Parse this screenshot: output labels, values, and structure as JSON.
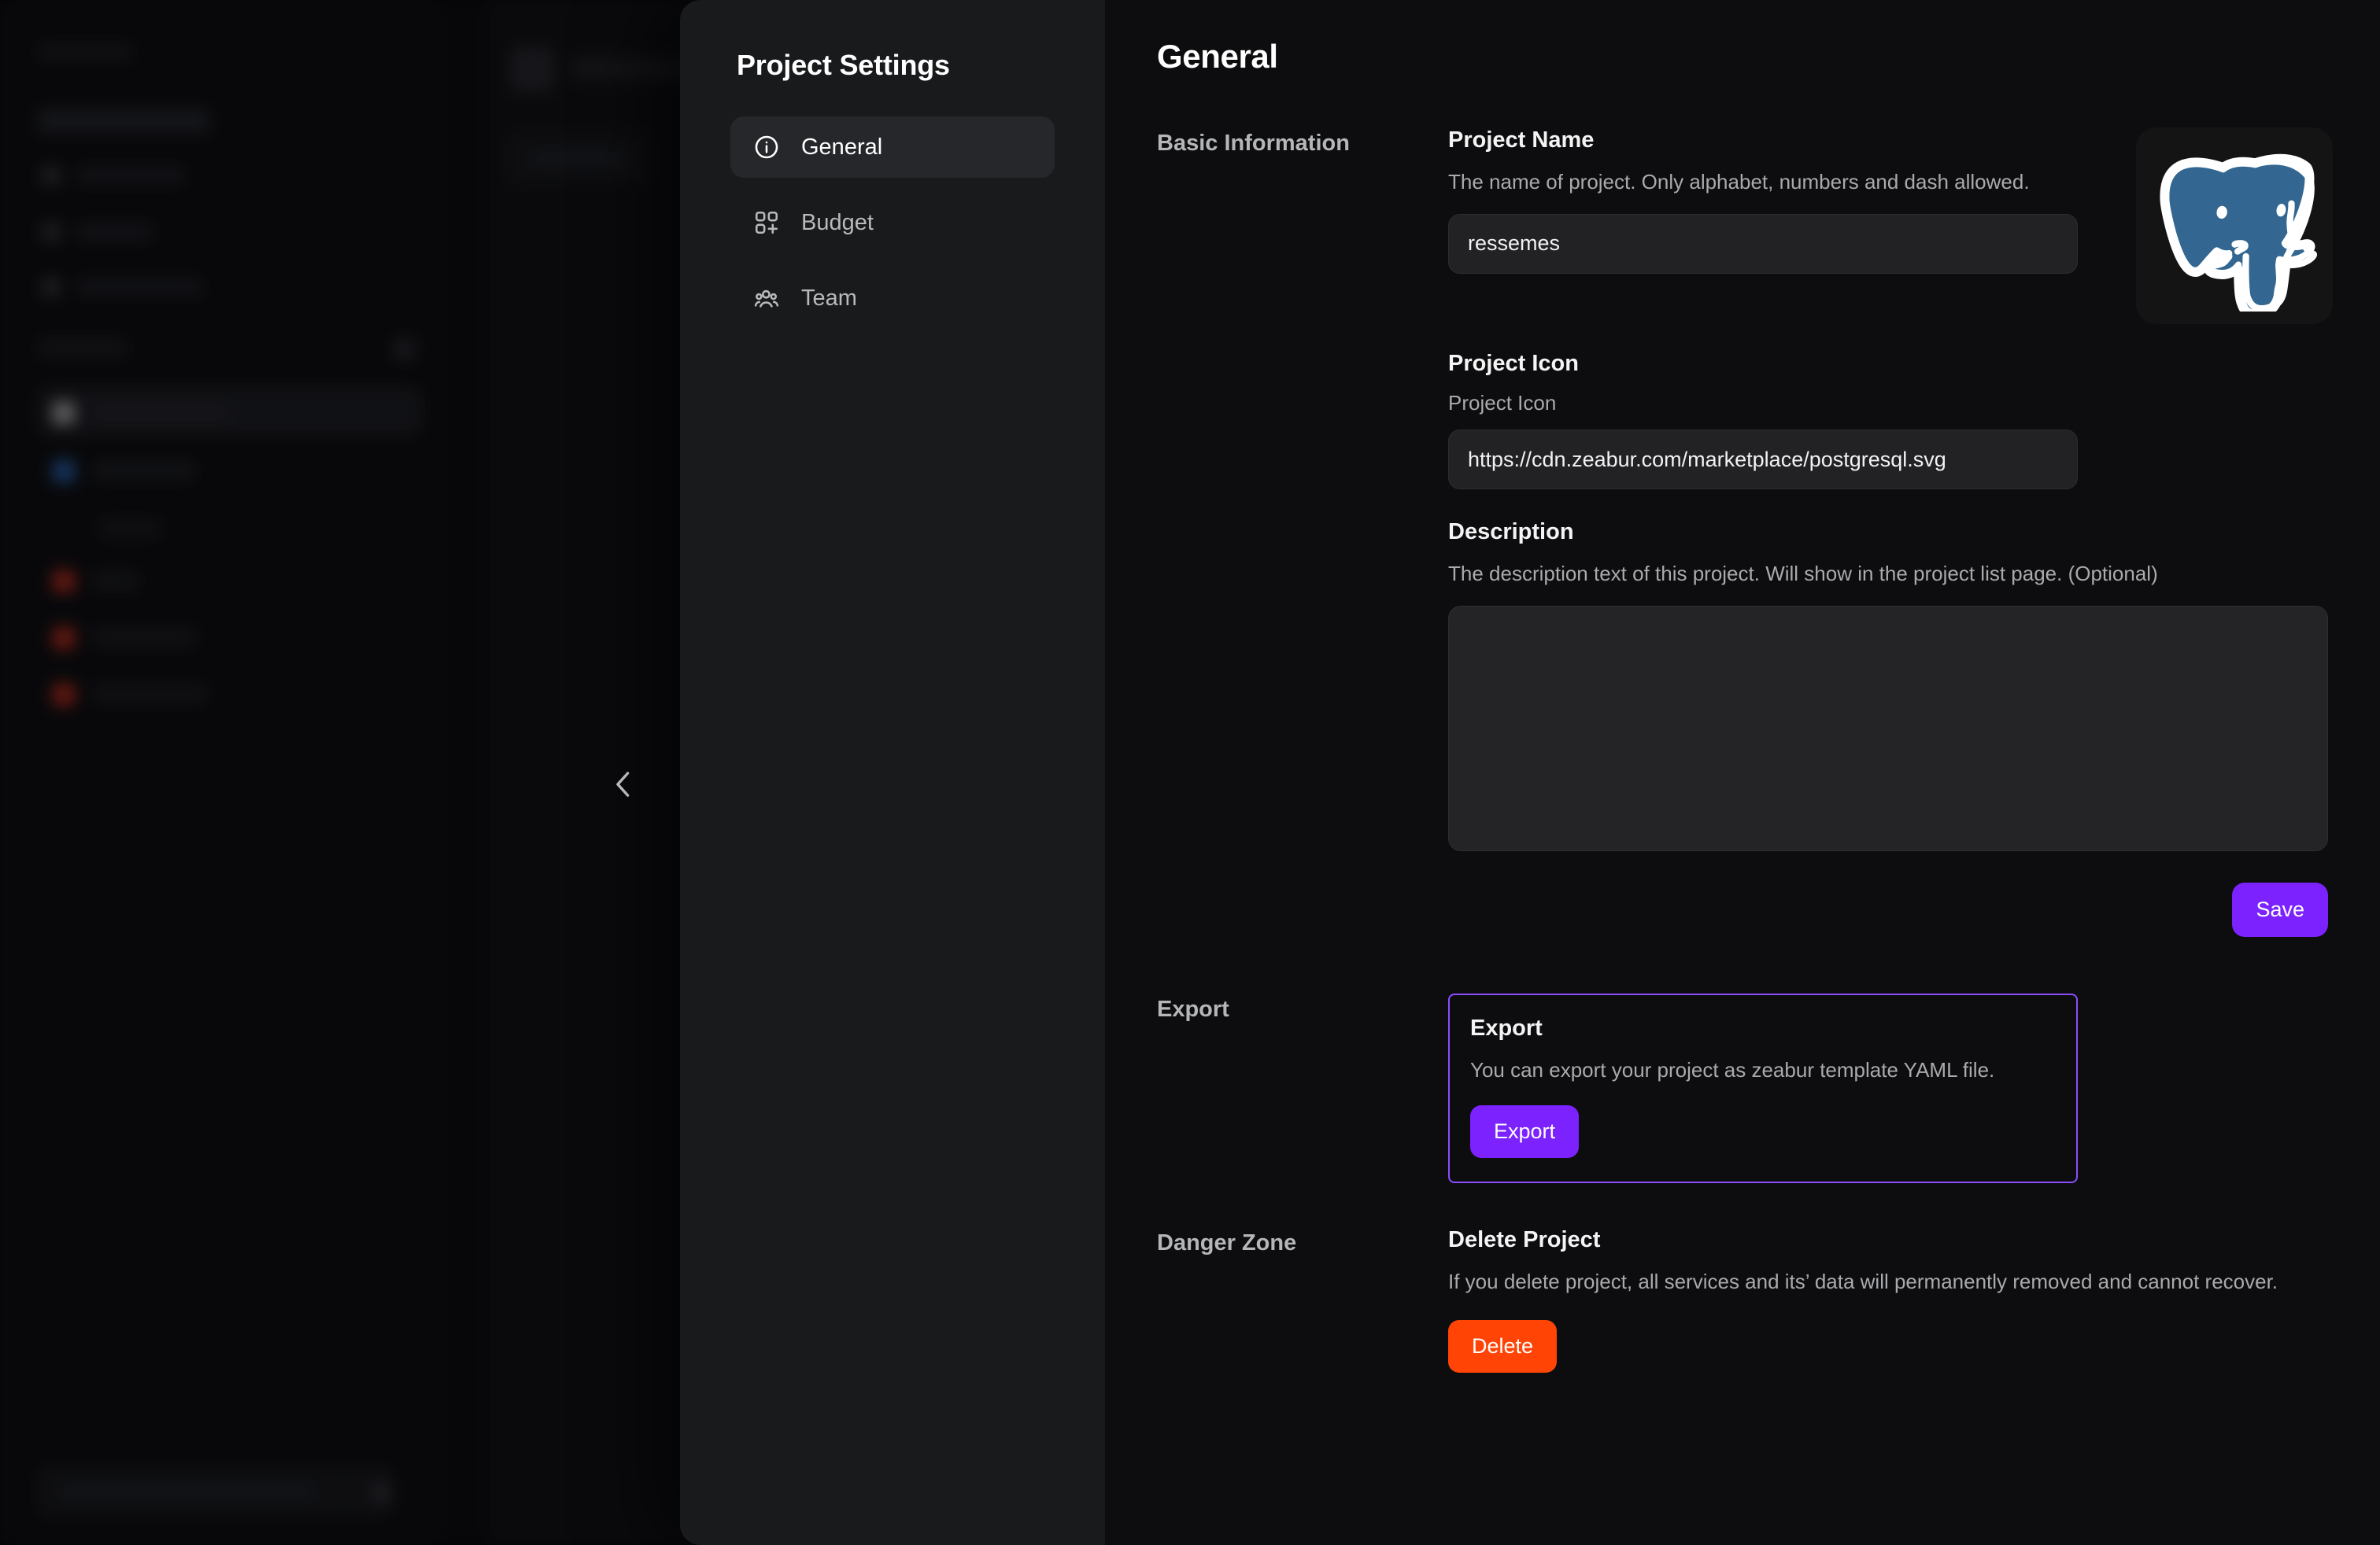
{
  "background": {
    "collapse_icon": "chevron-left-icon"
  },
  "settings_nav": {
    "title": "Project Settings",
    "items": [
      {
        "label": "General",
        "icon": "info-circle-icon",
        "active": true
      },
      {
        "label": "Budget",
        "icon": "layout-grid-plus-icon",
        "active": false
      },
      {
        "label": "Team",
        "icon": "users-group-icon",
        "active": false
      }
    ]
  },
  "main": {
    "page_title": "General",
    "sections": {
      "basic_information": {
        "label": "Basic Information",
        "project_name": {
          "title": "Project Name",
          "description": "The name of project. Only alphabet, numbers and dash allowed.",
          "value": "ressemes"
        },
        "project_icon": {
          "title": "Project Icon",
          "sublabel": "Project Icon",
          "value": "https://cdn.zeabur.com/marketplace/postgresql.svg",
          "preview_icon": "postgresql-elephant-icon"
        },
        "description": {
          "title": "Description",
          "description": "The description text of this project. Will show in the project list page. (Optional)",
          "value": "",
          "placeholder": ""
        },
        "save_label": "Save"
      },
      "export": {
        "label": "Export",
        "title": "Export",
        "description": "You can export your project as zeabur template YAML file.",
        "button_label": "Export"
      },
      "danger_zone": {
        "label": "Danger Zone",
        "title": "Delete Project",
        "description": "If you delete project, all services and its’ data will permanently removed and cannot recover.",
        "button_label": "Delete"
      }
    }
  },
  "colors": {
    "accent_purple": "#7b22ff",
    "export_border": "#8b4dff",
    "danger_orange": "#ff4405",
    "modal_nav_bg": "#191a1c",
    "modal_main_bg": "#0d0d0f",
    "nav_active_bg": "#26272a",
    "input_bg": "#222224",
    "textarea_bg": "#242426",
    "postgres_blue": "#336791"
  }
}
